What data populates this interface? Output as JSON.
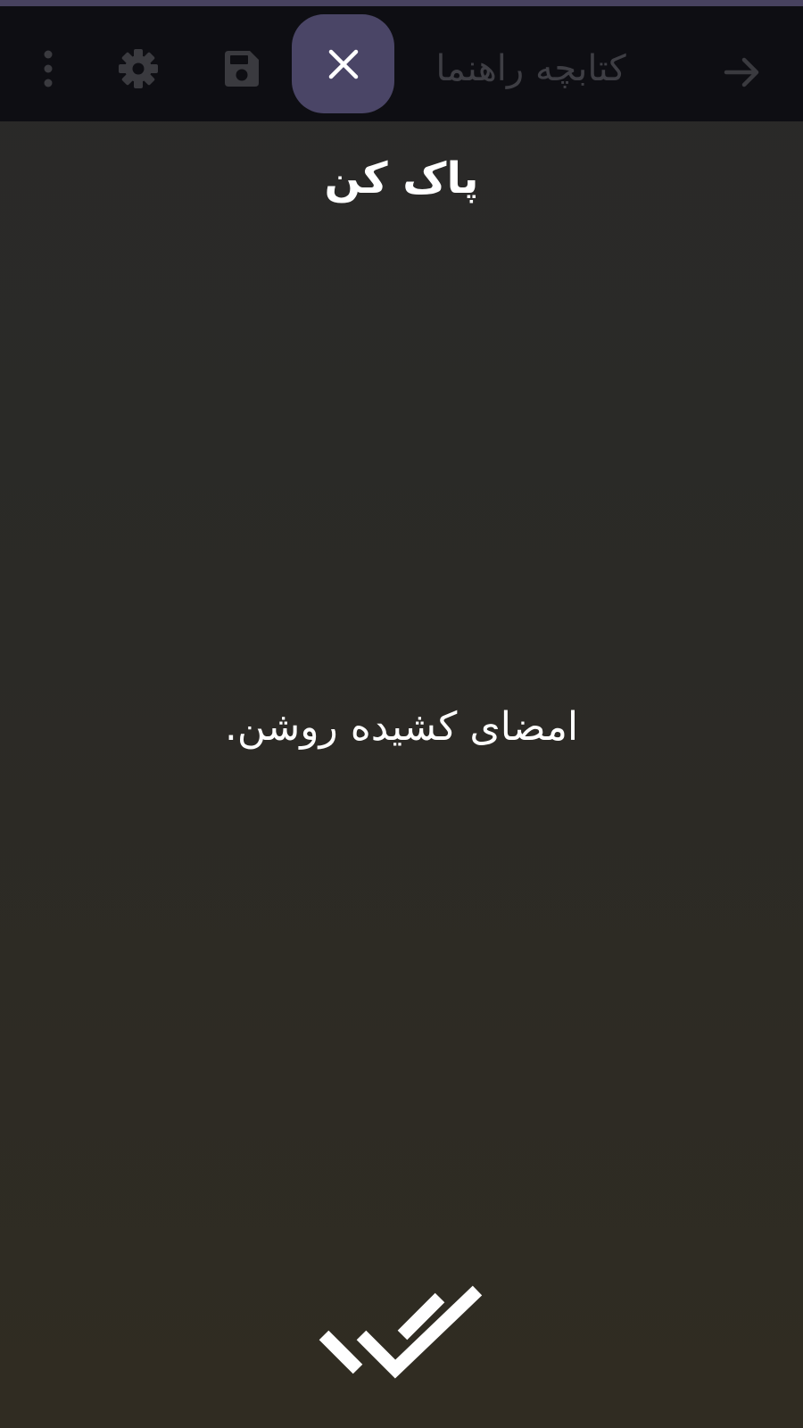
{
  "colors": {
    "status_strip": "#47425f",
    "toolbar_bg": "#0e0e13",
    "toolbar_icon": "#3a3a3f",
    "close_button_bg": "#4a4566",
    "text": "#ffffff"
  },
  "toolbar": {
    "title": "کتابچه راهنما",
    "back_icon": "arrow-forward-icon",
    "close_icon": "close-icon",
    "save_icon": "save-icon",
    "settings_icon": "gear-icon",
    "overflow_icon": "more-vertical-icon"
  },
  "signature": {
    "clear_label": "پاک کن",
    "hint": "امضای کشیده روشن.",
    "confirm_icon": "double-check-icon"
  }
}
